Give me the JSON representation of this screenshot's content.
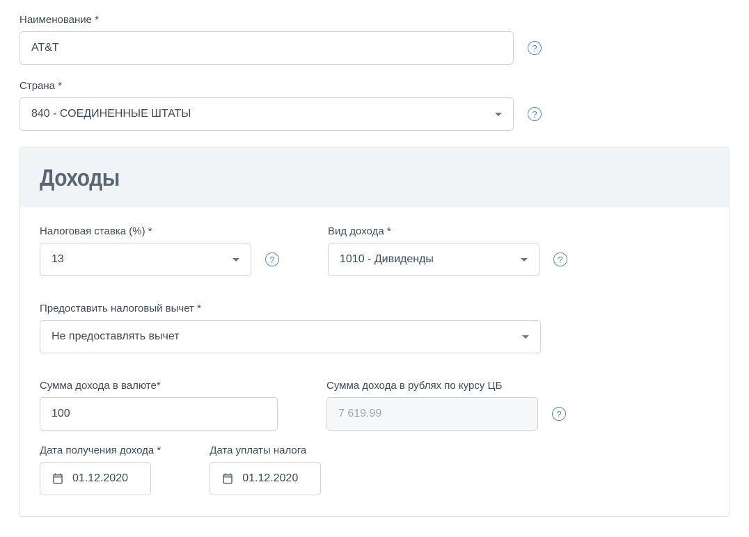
{
  "name": {
    "label": "Наименование *",
    "value": "AT&T"
  },
  "country": {
    "label": "Страна *",
    "value": "840 - СОЕДИНЕННЫЕ ШТАТЫ"
  },
  "incomePanel": {
    "title": "Доходы"
  },
  "taxRate": {
    "label": "Налоговая ставка (%) *",
    "value": "13"
  },
  "incomeType": {
    "label": "Вид дохода *",
    "value": "1010 - Дивиденды"
  },
  "deduction": {
    "label": "Предоставить налоговый вычет *",
    "value": "Не предоставлять вычет"
  },
  "amountCurrency": {
    "label": "Сумма дохода в валюте*",
    "value": "100"
  },
  "amountRub": {
    "label": "Сумма дохода в рублях по курсу ЦБ",
    "value": "7 619.99"
  },
  "dateReceived": {
    "label": "Дата получения дохода *",
    "value": "01.12.2020"
  },
  "dateTaxPaid": {
    "label": "Дата уплаты налога",
    "value": "01.12.2020"
  }
}
